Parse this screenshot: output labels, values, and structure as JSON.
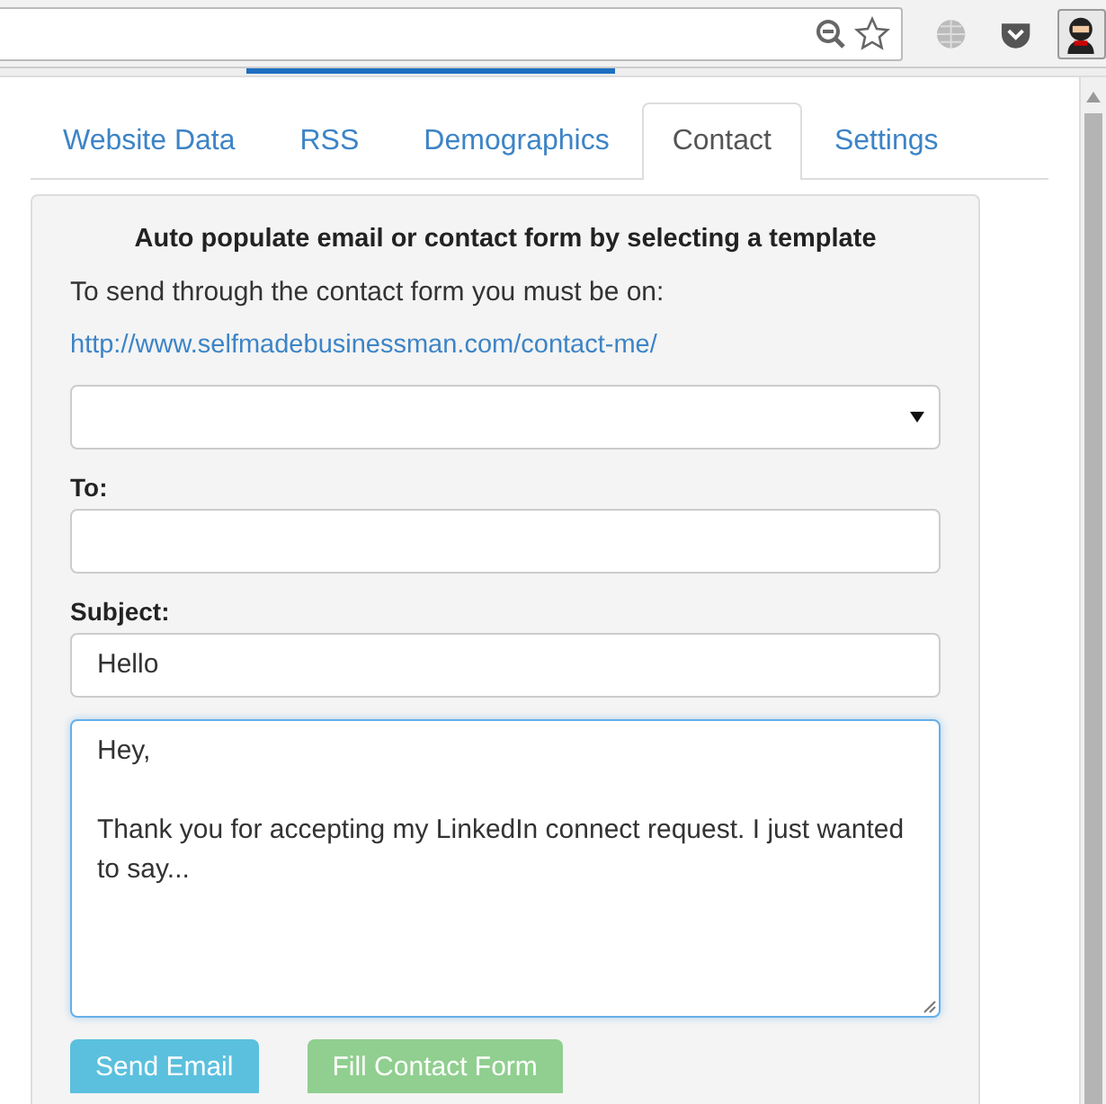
{
  "tabs": [
    {
      "label": "Website Data",
      "selected": false
    },
    {
      "label": "RSS",
      "selected": false
    },
    {
      "label": "Demographics",
      "selected": false
    },
    {
      "label": "Contact",
      "selected": true
    },
    {
      "label": "Settings",
      "selected": false
    }
  ],
  "contact": {
    "heading": "Auto populate email or contact form by selecting a template",
    "note": "To send through the contact form you must be on:",
    "link": "http://www.selfmadebusinessman.com/contact-me/",
    "to_label": "To:",
    "subject_label": "Subject:",
    "subject": "Hello",
    "message": "Hey,\n\nThank you for accepting my LinkedIn connect request. I just wanted to say..."
  },
  "buttons": [
    {
      "label": "Send Email",
      "kind": "info"
    },
    {
      "label": "Fill Contact Form",
      "kind": "success"
    }
  ]
}
